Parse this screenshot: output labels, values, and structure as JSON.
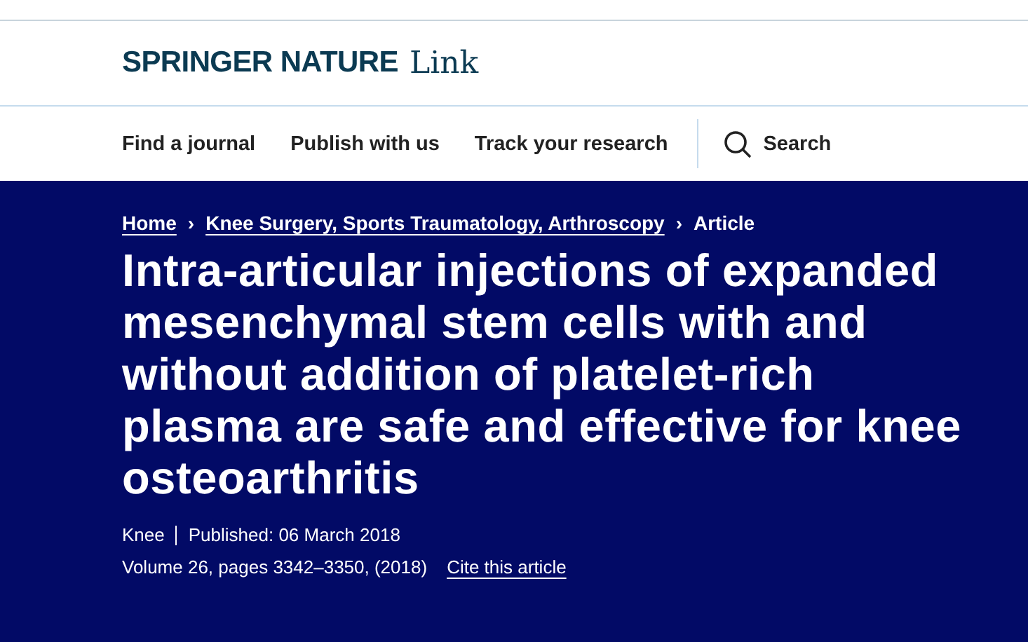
{
  "logo": {
    "brand": "SPRINGER NATURE",
    "product": "Link"
  },
  "nav": {
    "links": [
      "Find a journal",
      "Publish with us",
      "Track your research"
    ],
    "search": "Search"
  },
  "breadcrumbs": [
    {
      "label": "Home",
      "link": true
    },
    {
      "label": "Knee Surgery, Sports Traumatology, Arthroscopy",
      "link": true
    },
    {
      "label": "Article",
      "link": false
    }
  ],
  "separator": "›",
  "title": "Intra-articular injections of expanded mesenchymal stem cells with and without addition of platelet-rich plasma are safe and effective for knee osteoarthritis",
  "meta": {
    "type": "Knee",
    "published": "Published: 06 March 2018",
    "citation": "Volume 26, pages 3342–3350, (2018)",
    "cite_link": "Cite this article"
  }
}
